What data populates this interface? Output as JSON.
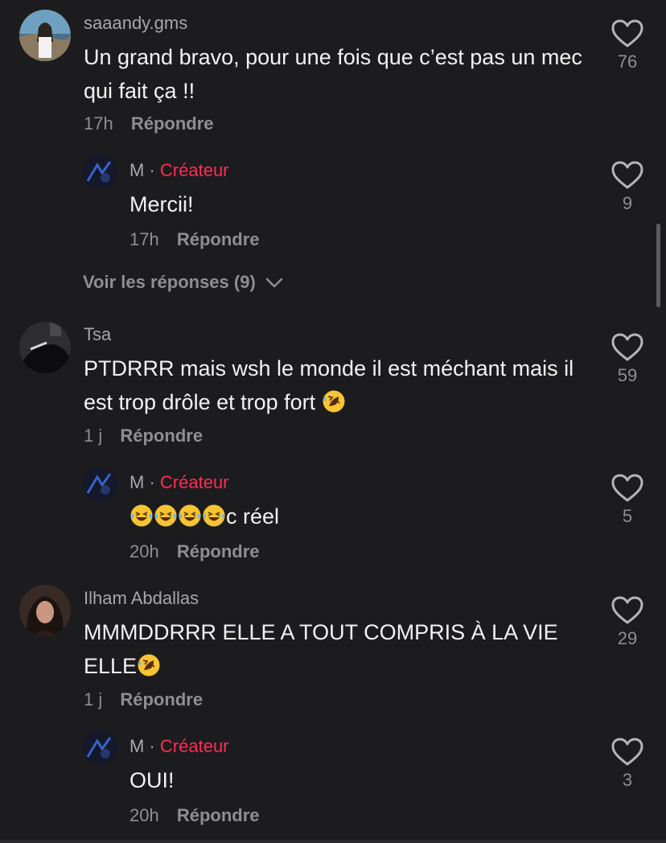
{
  "comments": [
    {
      "user": "saaandy.gms",
      "text": "Un grand bravo, pour une fois que c’est pas un mec qui fait ça !!",
      "time": "17h",
      "reply_label": "Répondre",
      "likes": "76",
      "reply": {
        "user": "M",
        "separator": "·",
        "badge": "Créateur",
        "text": "Mercii!",
        "time": "17h",
        "reply_label": "Répondre",
        "likes": "9"
      },
      "view_replies": "Voir les réponses (9)"
    },
    {
      "user": "Tsa",
      "text": "PTDRRR mais wsh le monde il est méchant mais il est trop drôle et trop fort",
      "text_emoji": "rolling-on-floor-laughing-emoji",
      "time": "1 j",
      "reply_label": "Répondre",
      "likes": "59",
      "reply": {
        "user": "M",
        "separator": "·",
        "badge": "Créateur",
        "text_prefix_emoji": "face-with-tears-of-joy-emoji x4",
        "text": "c réel",
        "time": "20h",
        "reply_label": "Répondre",
        "likes": "5"
      }
    },
    {
      "user": "Ilham Abdallas",
      "text": "MMMDDRRR ELLE A TOUT COMPRIS À LA VIE ELLE",
      "text_emoji": "rolling-on-floor-laughing-emoji",
      "time": "1 j",
      "reply_label": "Répondre",
      "likes": "29",
      "reply": {
        "user": "M",
        "separator": "·",
        "badge": "Créateur",
        "text": "OUI!",
        "time": "20h",
        "reply_label": "Répondre",
        "likes": "3"
      }
    }
  ],
  "colors": {
    "background": "#1c1c1e",
    "creator_badge": "#fe2c55",
    "secondary_text": "#8e8e93"
  },
  "icons": [
    "heart-outline-icon",
    "chevron-down-icon"
  ]
}
